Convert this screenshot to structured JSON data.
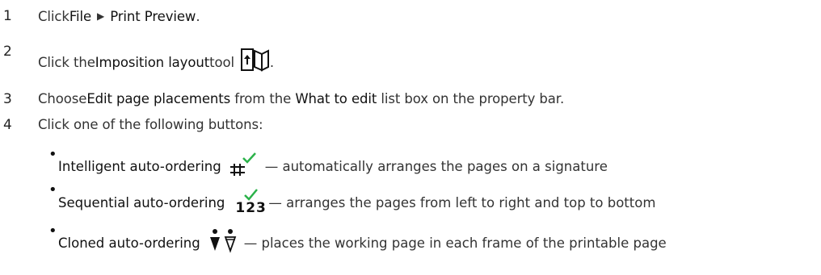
{
  "steps": [
    {
      "num": "1",
      "pre": "Click ",
      "ui1": "File",
      "arrow": "▶",
      "ui2": "Print Preview",
      "post": "."
    },
    {
      "num": "2",
      "pre": "Click the ",
      "ui1": "Imposition layout",
      "post1": " tool",
      "icon": "imposition-layout-icon",
      "post2": "."
    },
    {
      "num": "3",
      "pre": "Choose ",
      "ui1": "Edit page placements",
      "mid": " from the ",
      "ui2": "What to edit",
      "post": " list box on the property bar."
    },
    {
      "num": "4",
      "text": "Click one of the following buttons:"
    }
  ],
  "bullets": [
    {
      "label": "Intelligent auto-ordering",
      "icon": "intelligent-auto-ordering-icon",
      "desc": "— automatically arranges the pages on a signature"
    },
    {
      "label": "Sequential auto-ordering",
      "icon": "sequential-auto-ordering-icon",
      "icon_text": "123",
      "desc": "— arranges the pages from left to right and top to bottom"
    },
    {
      "label": "Cloned auto-ordering",
      "icon": "cloned-auto-ordering-icon",
      "desc": "— places the working page in each frame of the printable page"
    }
  ],
  "colors": {
    "check": "#2bb24a",
    "text": "#333333"
  }
}
